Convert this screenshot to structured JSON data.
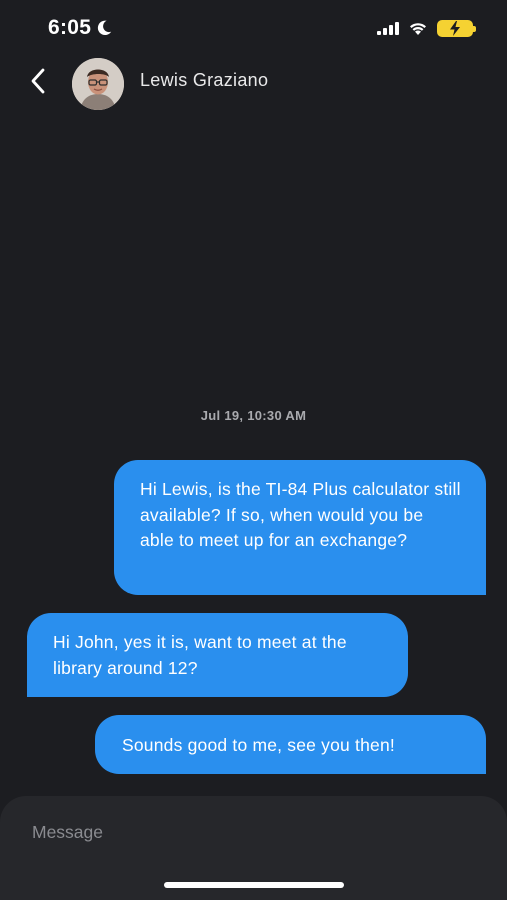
{
  "status_bar": {
    "time": "6:05",
    "moon_icon": "moon-icon",
    "signal_icon": "cellular-signal-icon",
    "wifi_icon": "wifi-icon",
    "battery_icon": "battery-charging-icon",
    "battery_color": "#f5d232"
  },
  "header": {
    "back_icon": "chevron-left-icon",
    "contact_name": "Lewis Graziano",
    "avatar": "contact-avatar"
  },
  "conversation": {
    "timestamp": "Jul 19, 10:30 AM",
    "messages": [
      {
        "direction": "outgoing",
        "text": "Hi Lewis, is the TI-84 Plus calculator still available? If so, when would you be able to meet up for an exchange?"
      },
      {
        "direction": "incoming",
        "text": "Hi John, yes it is, want to meet at the library around 12?"
      },
      {
        "direction": "outgoing",
        "text": "Sounds good to me, see you then!"
      }
    ]
  },
  "composer": {
    "placeholder": "Message",
    "value": ""
  },
  "colors": {
    "background": "#1c1d21",
    "bubble": "#2a8fee",
    "composer": "#26272b"
  }
}
